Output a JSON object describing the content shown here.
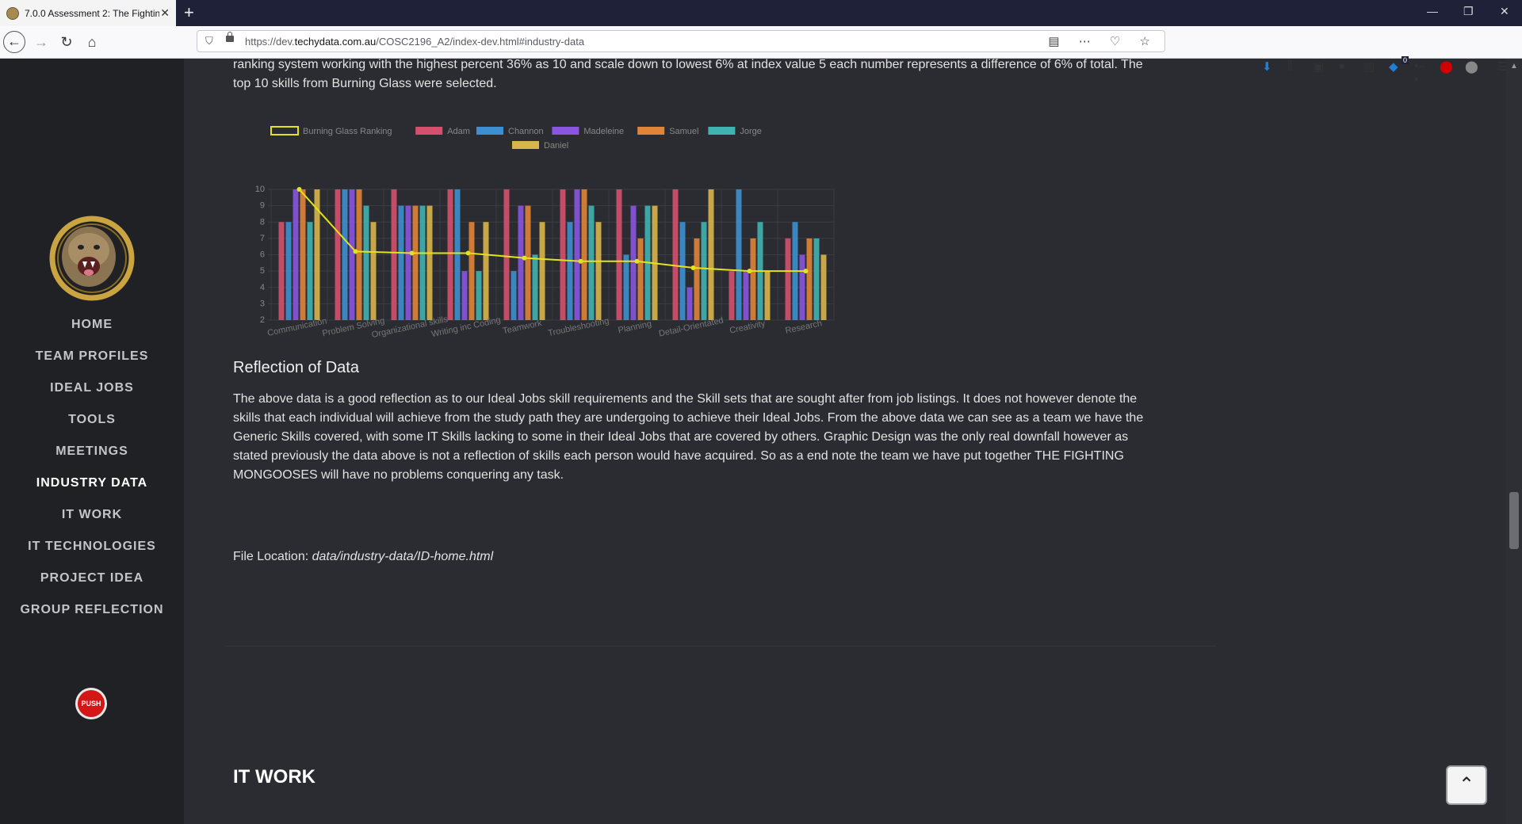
{
  "browser": {
    "tab_title": "7.0.0 Assessment 2: The Fightin",
    "url_prefix": "https://dev.",
    "url_domain": "techydata.com.au",
    "url_path": "/COSC2196_A2/index-dev.html#industry-data",
    "new_tab": "+",
    "badge_count": "0"
  },
  "sidebar": {
    "items": [
      {
        "label": "HOME"
      },
      {
        "label": "TEAM PROFILES"
      },
      {
        "label": "IDEAL JOBS"
      },
      {
        "label": "TOOLS"
      },
      {
        "label": "MEETINGS"
      },
      {
        "label": "INDUSTRY DATA"
      },
      {
        "label": "IT WORK"
      },
      {
        "label": "IT TECHNOLOGIES"
      },
      {
        "label": "PROJECT IDEA"
      },
      {
        "label": "GROUP REFLECTION"
      }
    ],
    "push_label": "PUSH"
  },
  "main": {
    "intro_line1": "ranking system working with the highest percent 36% as 10 and scale down to lowest 6% at index value 5 each number represents a difference of 6% of total. The",
    "intro_line2": "top 10 skills from Burning Glass were selected.",
    "reflection_heading": "Reflection of Data",
    "reflection_lines": [
      "The above data is a good reflection as to our Ideal Jobs skill requirements and the Skill sets that are sought after from job listings. It does not however denote the",
      "skills that each individual will achieve from the study path they are undergoing to achieve their Ideal Jobs. From the above data we can see as a team we have the",
      "Generic Skills covered, with some IT Skills lacking to some in their Ideal Jobs that are covered by others. Graphic Design was the only real downfall however as",
      "stated previously the data above is not a reflection of skills each person would have acquired. So as a end note the team we have put together THE FIGHTING",
      "MONGOOSES will have no problems conquering any task."
    ],
    "file_location_label": "File Location:",
    "file_location_path": "data/industry-data/ID-home.html",
    "next_section_heading": "IT WORK"
  },
  "chart_data": {
    "type": "bar",
    "categories": [
      "Communication",
      "Problem Solving",
      "Organizational skills",
      "Writing inc Coding",
      "Teamwork",
      "Troubleshooting",
      "Planning",
      "Detail-Orientated",
      "Creativity",
      "Research"
    ],
    "ylim": [
      2,
      10
    ],
    "yticks": [
      2,
      3,
      4,
      5,
      6,
      7,
      8,
      9,
      10
    ],
    "grid": true,
    "legend_position": "top",
    "line_series": {
      "name": "Burning Glass Ranking",
      "color": "#e3e31b",
      "values": [
        10,
        6.2,
        6.1,
        6.1,
        5.8,
        5.6,
        5.6,
        5.2,
        5,
        5
      ]
    },
    "series": [
      {
        "name": "Adam",
        "color": "#d4506e",
        "values": [
          8,
          10,
          10,
          10,
          10,
          10,
          10,
          10,
          5,
          7
        ]
      },
      {
        "name": "Channon",
        "color": "#3d8fd1",
        "values": [
          8,
          10,
          9,
          10,
          5,
          8,
          6,
          8,
          10,
          8
        ]
      },
      {
        "name": "Madeleine",
        "color": "#8a55e0",
        "values": [
          10,
          10,
          9,
          5,
          9,
          10,
          9,
          4,
          5,
          6
        ]
      },
      {
        "name": "Samuel",
        "color": "#e0843a",
        "values": [
          10,
          10,
          9,
          8,
          9,
          10,
          7,
          7,
          7,
          7
        ]
      },
      {
        "name": "Jorge",
        "color": "#3fb3b0",
        "values": [
          8,
          9,
          9,
          5,
          6,
          9,
          9,
          8,
          8,
          7
        ]
      },
      {
        "name": "Daniel",
        "color": "#d8b54a",
        "values": [
          10,
          8,
          9,
          8,
          8,
          8,
          9,
          10,
          5,
          6
        ]
      }
    ]
  }
}
